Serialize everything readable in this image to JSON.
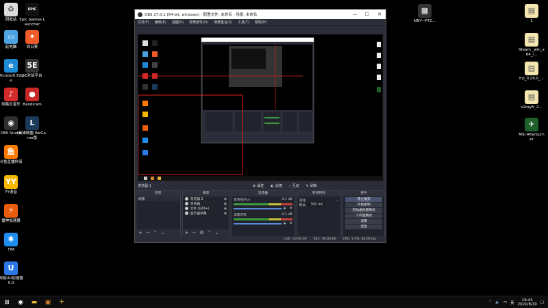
{
  "desktop_icons_left": [
    {
      "label": "回收站",
      "icon": "recycle-bin-icon",
      "color": "#dcdcdc",
      "glyph": "♻"
    },
    {
      "label": "Epic Games Launcher",
      "icon": "epic-games-icon",
      "color": "#111111",
      "glyph": "EPIC"
    },
    {
      "label": "此电脑",
      "icon": "computer-icon",
      "color": "#4aa3e0",
      "glyph": "▭"
    },
    {
      "label": "向日葵",
      "icon": "sunflower-icon",
      "color": "#f05a28",
      "glyph": "✦"
    },
    {
      "label": "Microsoft Edge",
      "icon": "edge-icon",
      "color": "#1e8ad6",
      "glyph": "e"
    },
    {
      "label": "5E对战平台",
      "icon": "5e-platform-icon",
      "color": "#333333",
      "glyph": "5E"
    },
    {
      "label": "网易云音乐",
      "icon": "netease-music-icon",
      "color": "#d32a2a",
      "glyph": "♪"
    },
    {
      "label": "Bandicam",
      "icon": "bandicam-icon",
      "color": "#c62828",
      "glyph": "●"
    },
    {
      "label": "OBS Studio",
      "icon": "obs-icon",
      "color": "#302e31",
      "glyph": "◉"
    },
    {
      "label": "英雄联盟 WeGame版",
      "icon": "lol-wegame-icon",
      "color": "#1b3a5c",
      "glyph": "L"
    },
    {
      "label": "斗鱼直播伴侣",
      "icon": "douyu-icon",
      "color": "#ff7a00",
      "glyph": "鱼"
    },
    {
      "label": "YY语音",
      "icon": "yy-voice-icon",
      "color": "#f6b800",
      "glyph": "YY"
    },
    {
      "label": "雷神加速器",
      "icon": "leishen-icon",
      "color": "#e85c0d",
      "glyph": "⚡"
    },
    {
      "label": "TIM",
      "icon": "tim-icon",
      "color": "#1d8ef0",
      "glyph": "✱"
    },
    {
      "label": "网易UU加速器5.0",
      "icon": "uu-accelerator-icon",
      "color": "#2c77e6",
      "glyph": "U"
    }
  ],
  "desktop_icons_right": [
    {
      "label": "NNY~P72...",
      "icon": "nny-file-icon",
      "color": "#333333",
      "glyph": "▦"
    },
    {
      "label": "1",
      "icon": "document-1-icon",
      "color": "#f3e6b0",
      "glyph": "▤"
    },
    {
      "label": "Steam _win_x64_i...",
      "icon": "steam-file-icon",
      "color": "#f3e6b0",
      "glyph": "▤"
    },
    {
      "label": "frp_0.29.0_...",
      "icon": "frp-file-icon",
      "color": "#f3e6b0",
      "glyph": "▤"
    },
    {
      "label": "v2rayN_2...",
      "icon": "v2rayn-file-icon",
      "color": "#f3e6b0",
      "glyph": "▤"
    },
    {
      "label": "MSI Afterburner",
      "icon": "msi-afterburner-icon",
      "color": "#1f5f2a",
      "glyph": "✈"
    }
  ],
  "obs": {
    "title": "OBS 27.0.1 (64-bit, windows) - 配置文件: 未命名 - 场景: 未命名",
    "menu": [
      "文件(F)",
      "编辑(E)",
      "视图(V)",
      "停靠部件(D)",
      "场景集合(S)",
      "工具(T)",
      "帮助(H)"
    ],
    "preview_strip": {
      "scene_label": "浏览器 1",
      "buttons": [
        "属性",
        "滤镜",
        "互动",
        "刷新"
      ]
    },
    "docks": {
      "scenes": {
        "title": "场景",
        "items": [
          "场景"
        ]
      },
      "sources": {
        "title": "来源",
        "items": [
          "浏览器 2",
          "浏览器",
          "文本 (GDI+)",
          "显示器采集"
        ]
      },
      "mixer": {
        "title": "混音器",
        "tracks": [
          {
            "name": "麦克风/Aux",
            "db": "-0.1 dB"
          },
          {
            "name": "桌面音频",
            "db": "-0.1 dB"
          }
        ]
      },
      "transitions": {
        "title": "转场特效",
        "type": "淡化",
        "duration_label": "时长",
        "duration": "300 ms"
      },
      "controls": {
        "title": "控件",
        "buttons": [
          "停止推流",
          "开始录制",
          "启动虚拟摄像机",
          "工作室模式",
          "设置",
          "退出"
        ]
      }
    },
    "status": {
      "live": "LIVE: 00:00:00",
      "rec": "REC: 00:00:00",
      "cpu": "CPU: 3.5%, 60.00 fps"
    }
  },
  "taskbar": {
    "clock_time": "19:43",
    "clock_date": "2021/8/19",
    "ime": "英"
  }
}
